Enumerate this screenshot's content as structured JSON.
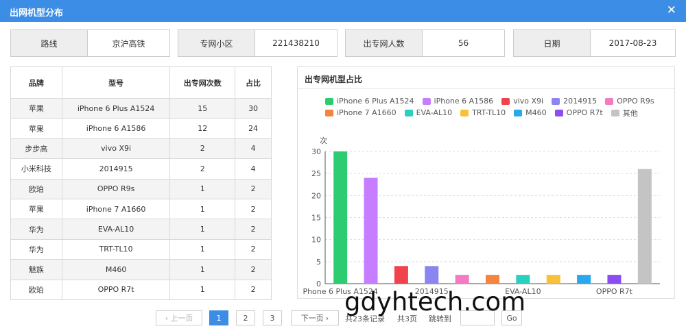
{
  "window": {
    "title": "出网机型分布",
    "close_glyph": "✕"
  },
  "info": [
    {
      "label": "路线",
      "value": "京沪高铁"
    },
    {
      "label": "专网小区",
      "value": "221438210"
    },
    {
      "label": "出专网人数",
      "value": "56"
    },
    {
      "label": "日期",
      "value": "2017-08-23"
    }
  ],
  "table": {
    "headers": [
      "品牌",
      "型号",
      "出专网次数",
      "占比"
    ],
    "rows": [
      [
        "苹果",
        "iPhone 6 Plus A1524",
        "15",
        "30"
      ],
      [
        "苹果",
        "iPhone 6 A1586",
        "12",
        "24"
      ],
      [
        "步步高",
        "vivo X9i",
        "2",
        "4"
      ],
      [
        "小米科技",
        "2014915",
        "2",
        "4"
      ],
      [
        "欧珀",
        "OPPO R9s",
        "1",
        "2"
      ],
      [
        "苹果",
        "iPhone 7 A1660",
        "1",
        "2"
      ],
      [
        "华为",
        "EVA-AL10",
        "1",
        "2"
      ],
      [
        "华为",
        "TRT-TL10",
        "1",
        "2"
      ],
      [
        "魅族",
        "M460",
        "1",
        "2"
      ],
      [
        "欧珀",
        "OPPO R7t",
        "1",
        "2"
      ]
    ]
  },
  "chart_panel": {
    "title": "出专网机型占比"
  },
  "chart_data": {
    "type": "bar",
    "ylabel": "次",
    "ylim": [
      0,
      30
    ],
    "yticks": [
      0,
      5,
      10,
      15,
      20,
      25,
      30
    ],
    "grid": true,
    "legend_position": "top",
    "categories": [
      "iPhone 6 Plus A1524",
      "iPhone 6 A1586",
      "vivo X9i",
      "2014915",
      "OPPO R9s",
      "iPhone 7 A1660",
      "EVA-AL10",
      "TRT-TL10",
      "M460",
      "OPPO R7t",
      "其他"
    ],
    "values": [
      30,
      24,
      4,
      4,
      2,
      2,
      2,
      2,
      2,
      2,
      26
    ],
    "colors": [
      "#2ecc71",
      "#c77dff",
      "#f0434b",
      "#8c84f0",
      "#f47ac3",
      "#f5843f",
      "#2ad0be",
      "#f9c13a",
      "#29a8ee",
      "#8b4cf2",
      "#c4c4c4"
    ],
    "shown_xtick_labels": [
      "Phone 6 Plus A1524",
      "2014915",
      "EVA-AL10",
      "OPPO R7t"
    ]
  },
  "pager": {
    "prev": "上一页",
    "pages": [
      "1",
      "2",
      "3"
    ],
    "active_page": "1",
    "next": "下一页",
    "total_records": "共23条记录",
    "total_pages": "共3页",
    "jump_label": "跳转到",
    "go": "Go"
  },
  "watermark": "gdyhtech.com"
}
